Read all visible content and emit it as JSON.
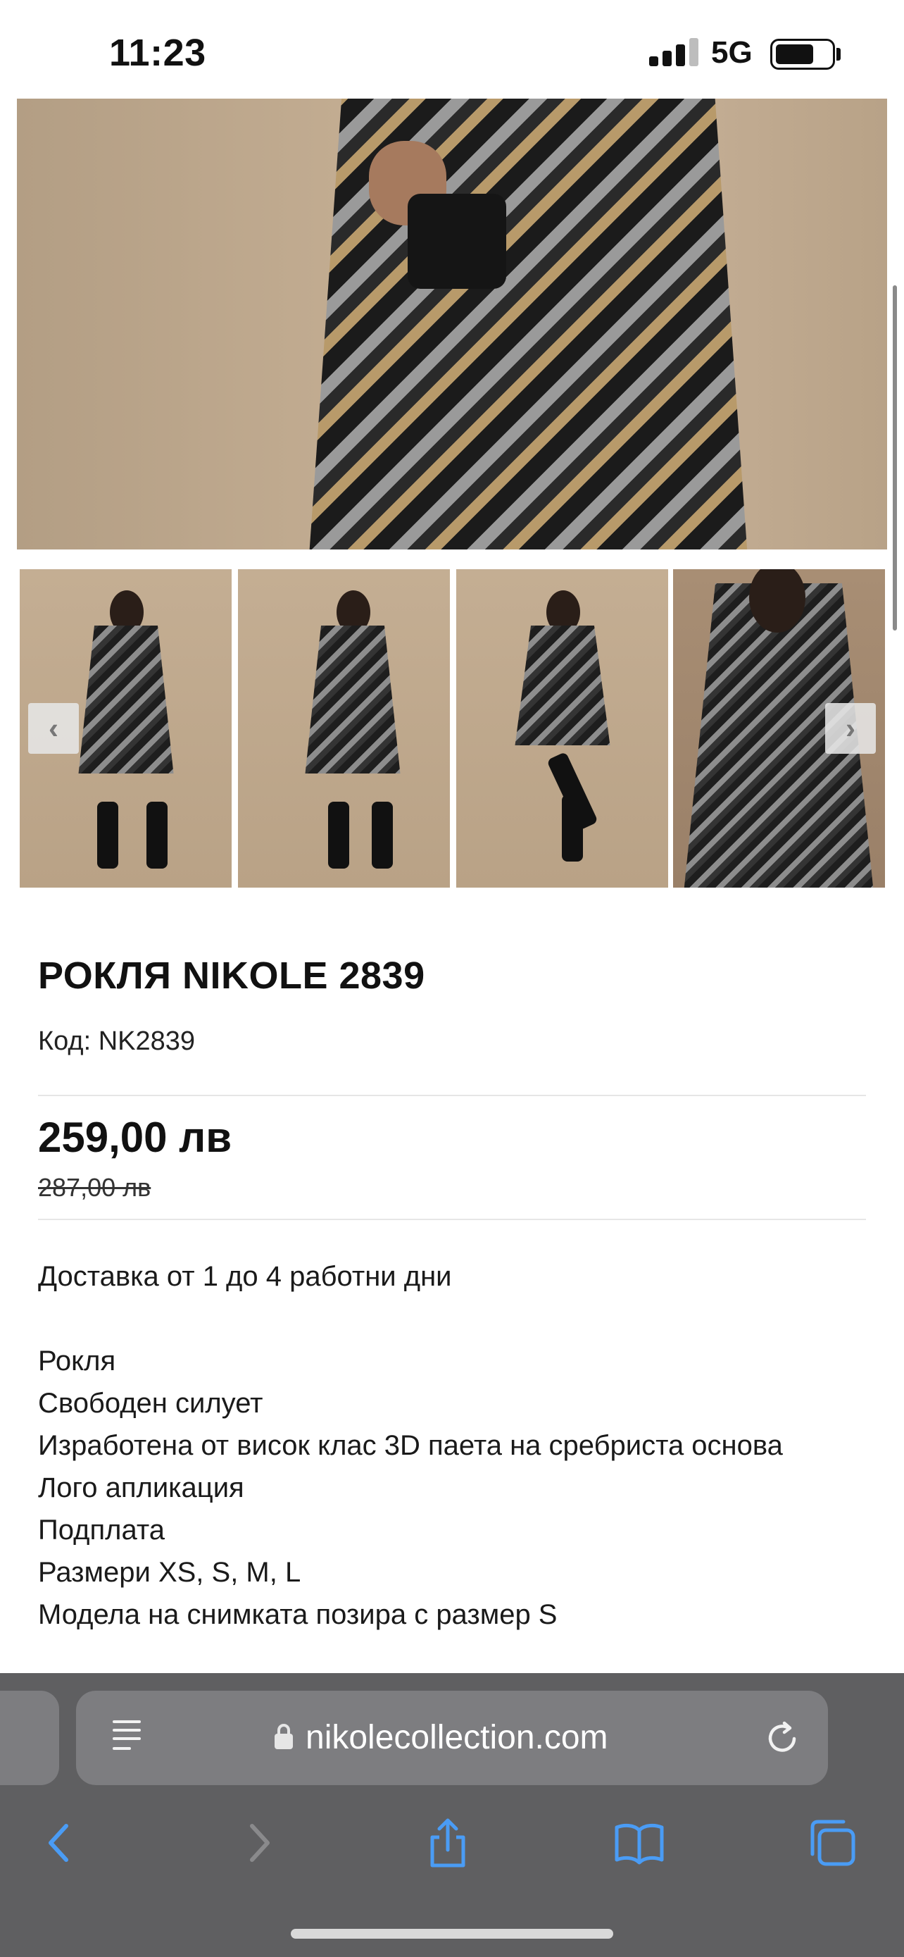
{
  "status_bar": {
    "time": "11:23",
    "network": "5G",
    "icons": [
      "cellular-signal-icon",
      "battery-icon"
    ]
  },
  "product": {
    "title": "РОКЛЯ NIKOLE 2839",
    "code": "Код: NK2839",
    "price": "259,00 лв",
    "old_price": "287,00 лв",
    "delivery": "Доставка от 1 до 4 работни дни",
    "description": [
      "Рокля",
      "Свободен силует",
      "Изработена от висок клас 3D паета на сребриста основа",
      "Лого апликация",
      "Подплата",
      "Размери XS, S, M, L",
      "Модела на снимката позира с размер S"
    ]
  },
  "gallery": {
    "prev_icon": "chevron-left-icon",
    "next_icon": "chevron-right-icon",
    "thumbnail_count": 4
  },
  "browser": {
    "url": "nikolecollection.com",
    "icons": [
      "reader-icon",
      "lock-icon",
      "reload-icon",
      "back-icon",
      "forward-icon",
      "share-icon",
      "bookmarks-icon",
      "tabs-icon"
    ],
    "accent": "#4a9cf5",
    "disabled_color": "#8a8a8c"
  }
}
